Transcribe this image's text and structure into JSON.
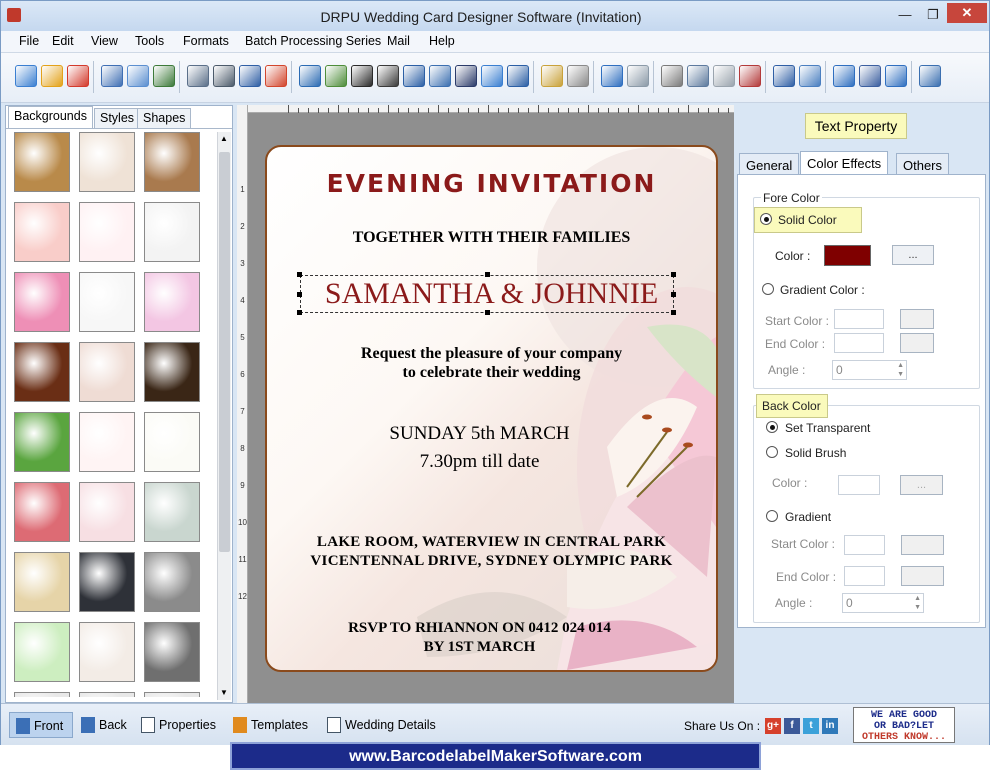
{
  "window": {
    "title": "DRPU Wedding Card Designer Software (Invitation)",
    "minimize": "—",
    "restore": "❐",
    "close": "✕"
  },
  "menu": [
    "File",
    "Edit",
    "View",
    "Tools",
    "Formats",
    "Batch Processing Series",
    "Mail",
    "Help"
  ],
  "toolbar_icons": [
    "new-icon",
    "open-icon",
    "close-file-icon",
    "save-icon",
    "save-as-icon",
    "export-icon",
    "properties-icon",
    "print-icon",
    "print-preview-icon",
    "gift-icon",
    "pencil-icon",
    "image-icon",
    "barcode-icon",
    "barcode2-icon",
    "text-icon",
    "word-art-icon",
    "signature-icon",
    "mail-icon",
    "line-icon",
    "database-icon",
    "database2-icon",
    "undo-icon",
    "redo-icon",
    "cut-icon",
    "copy-icon",
    "paste-icon",
    "delete-icon",
    "bring-front-icon",
    "send-back-icon",
    "grid-icon",
    "actual-size-icon",
    "fit-icon",
    "zoom-icon"
  ],
  "left_tabs": [
    "Backgrounds",
    "Styles",
    "Shapes"
  ],
  "thumbnails": [
    {
      "name": "bg-floral-gold",
      "color": "#b98a4a"
    },
    {
      "name": "bg-paisley",
      "color": "#efe2d6"
    },
    {
      "name": "bg-weave-brown",
      "color": "#a97a4e"
    },
    {
      "name": "bg-pink-flowers",
      "color": "#f9cdc9"
    },
    {
      "name": "bg-hearts-outline",
      "color": "#fff1f3"
    },
    {
      "name": "bg-temple",
      "color": "#f3f3f3"
    },
    {
      "name": "bg-pink-hearts",
      "color": "#ee8fb6"
    },
    {
      "name": "bg-couples",
      "color": "#f7f7f7"
    },
    {
      "name": "bg-pink-swirl",
      "color": "#f3c6e3"
    },
    {
      "name": "bg-ganesha",
      "color": "#6a2e15"
    },
    {
      "name": "bg-elephant",
      "color": "#efdcd4"
    },
    {
      "name": "bg-black-floral",
      "color": "#3a2616"
    },
    {
      "name": "bg-leaf-bird",
      "color": "#5aa53f"
    },
    {
      "name": "bg-rose-petals",
      "color": "#fff4f4"
    },
    {
      "name": "bg-crescent-star",
      "color": "#fbfbf6"
    },
    {
      "name": "bg-heart-pattern",
      "color": "#dd6b74"
    },
    {
      "name": "bg-pink-pattern",
      "color": "#f7dfe3"
    },
    {
      "name": "bg-mandala",
      "color": "#c9d6cf"
    },
    {
      "name": "bg-cream-rose",
      "color": "#e6d4a8"
    },
    {
      "name": "bg-dark-border",
      "color": "#2e3138"
    },
    {
      "name": "bg-lace-gray",
      "color": "#8b8b8b"
    },
    {
      "name": "bg-green-lace",
      "color": "#cdeec0"
    },
    {
      "name": "bg-white-floral",
      "color": "#f3ece6"
    },
    {
      "name": "bg-stripes-bw",
      "color": "#6f6f6f"
    },
    {
      "name": "bg-partial-1",
      "color": "#e8e8e8"
    },
    {
      "name": "bg-partial-2",
      "color": "#e8e8e8"
    },
    {
      "name": "bg-partial-3",
      "color": "#e8e8e8"
    }
  ],
  "ruler_ticks": [
    "1",
    "2",
    "3",
    "4",
    "5",
    "6",
    "7",
    "8",
    "9",
    "10",
    "11",
    "12"
  ],
  "card": {
    "title": "EVENING INVITATION",
    "line1": "TOGETHER WITH THEIR FAMILIES",
    "names": "SAMANTHA & JOHNNIE",
    "request1": "Request the pleasure of your company",
    "request2": "to celebrate their wedding",
    "date": "SUNDAY 5th MARCH",
    "time": "7.30pm till date",
    "venue1": "LAKE ROOM, WATERVIEW IN CENTRAL PARK",
    "venue2": "VICENTENNAL DRIVE,  SYDNEY OLYMPIC PARK",
    "rsvp1": "RSVP TO RHIANNON ON 0412 024 014",
    "rsvp2": "BY 1ST MARCH",
    "title_color": "#8b1a1a",
    "names_color": "#8b1a1a"
  },
  "right": {
    "header": "Text Property",
    "tabs": [
      "General",
      "Color Effects",
      "Others"
    ],
    "fore_color": {
      "legend": "Fore Color",
      "solid": "Solid Color",
      "color_label": "Color :",
      "color_value": "#7f0000",
      "browse": "...",
      "gradient": "Gradient Color :",
      "start": "Start Color :",
      "end": "End Color :",
      "angle": "Angle :",
      "angle_value": "0"
    },
    "back_color": {
      "legend": "Back Color",
      "transparent": "Set Transparent",
      "solid": "Solid Brush",
      "color_label": "Color :",
      "browse": "...",
      "gradient": "Gradient",
      "start": "Start Color :",
      "end": "End Color :",
      "angle": "Angle :",
      "angle_value": "0"
    }
  },
  "bottom": {
    "tabs": [
      "Front",
      "Back",
      "Properties",
      "Templates",
      "Wedding Details"
    ],
    "share": "Share Us On :",
    "social": [
      "g+",
      "f",
      "t",
      "in"
    ],
    "feedback": [
      "WE ARE GOOD",
      "OR BAD?LET",
      "OTHERS KNOW..."
    ]
  },
  "footer": "www.BarcodelabelMakerSoftware.com"
}
